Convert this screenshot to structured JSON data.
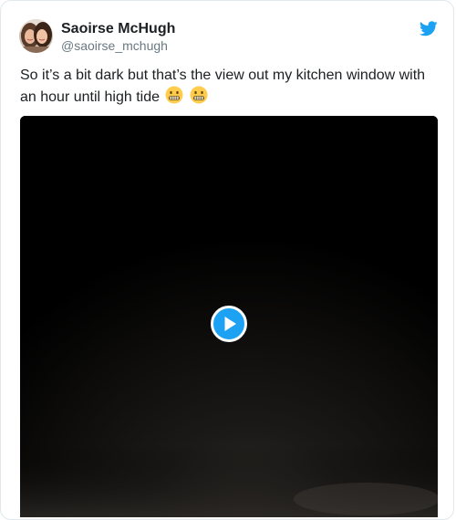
{
  "tweet": {
    "author_name": "Saoirse McHugh",
    "author_handle": "@saoirse_mchugh",
    "text": "So it’s a bit dark but that’s the view out my kitchen window with an hour until high tide",
    "emojis": [
      "grimacing-face-emoji",
      "grimacing-face-emoji"
    ],
    "brand_icon": "twitter-bird-icon",
    "media": {
      "type": "video",
      "control_icon": "play-icon"
    }
  },
  "colors": {
    "text_primary": "#1c2022",
    "text_secondary": "#697882",
    "twitter_blue": "#1da1f2",
    "border": "#e1e8ed",
    "emoji_yellow": "#ffcc4d",
    "video_bg": "#000000"
  }
}
